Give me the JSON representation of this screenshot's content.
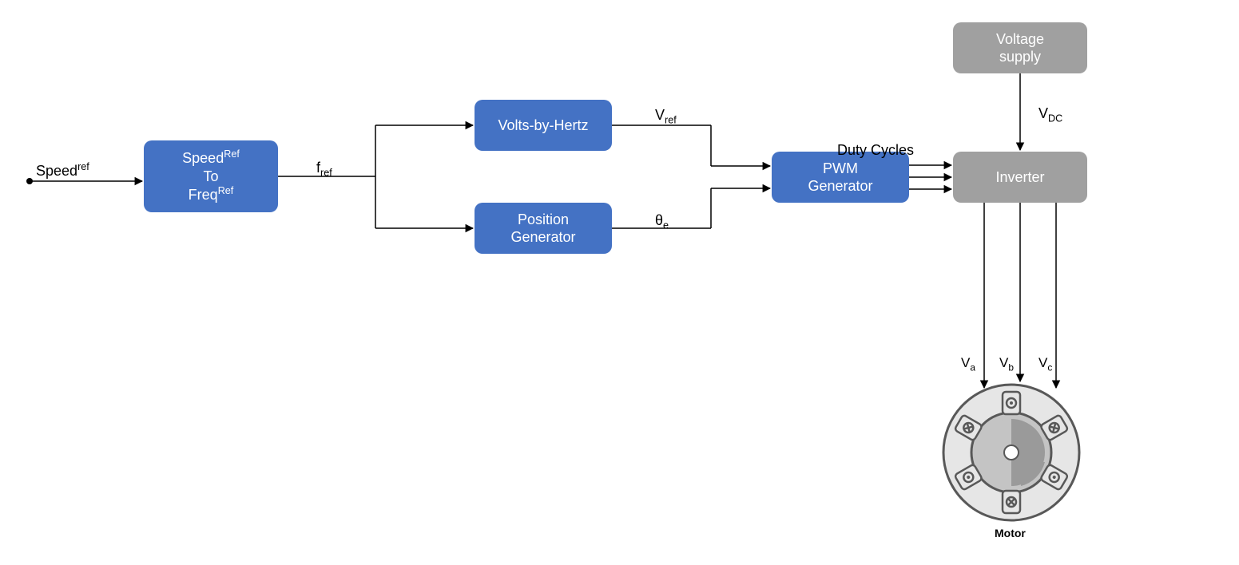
{
  "input": {
    "speed_ref": "Speed<sup>ref</sup>"
  },
  "blocks": {
    "speed_to_freq": "Speed<sup>Ref</sup><br>To<br>Freq<sup>Ref</sup>",
    "volts_by_hertz": "Volts-by-Hertz",
    "position_generator": "Position<br>Generator",
    "pwm_generator": "PWM<br>Generator",
    "voltage_supply": "Voltage<br>supply",
    "inverter": "Inverter"
  },
  "signals": {
    "f_ref": "f<sub>ref</sub>",
    "v_ref": "V<sub>ref</sub>",
    "theta_e": "θ<sub>e</sub>",
    "duty_cycles": "Duty Cycles",
    "v_dc": "V<sub>DC</sub>",
    "v_a": "V<sub>a</sub>",
    "v_b": "V<sub>b</sub>",
    "v_c": "V<sub>c</sub>"
  },
  "motor": {
    "label": "Motor"
  }
}
